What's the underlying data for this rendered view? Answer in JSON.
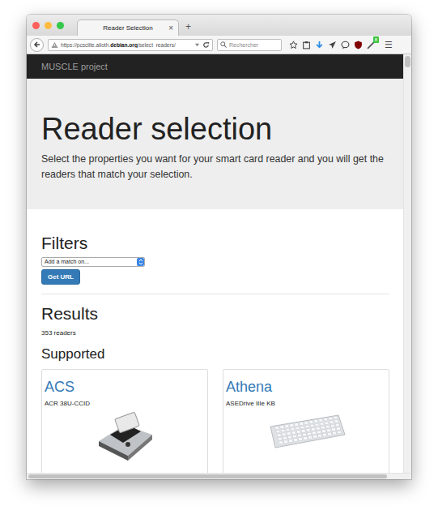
{
  "window": {
    "title": "Reader Selection",
    "tab_close": "×",
    "new_tab": "+"
  },
  "toolbar": {
    "url": {
      "prefix": "https://pcsclite.alioth.",
      "domain": "debian.org",
      "path": "/select_readers/"
    },
    "search": {
      "placeholder": "Rechercher"
    },
    "badge": "8",
    "menu": "☰"
  },
  "navbar": {
    "brand": "MUSCLE project"
  },
  "jumbotron": {
    "title": "Reader selection",
    "lead": "Select the properties you want for your smart card reader and you will get the readers that match your selection."
  },
  "filters": {
    "heading": "Filters",
    "select_placeholder": "Add a match on...",
    "button": "Get URL"
  },
  "results": {
    "heading": "Results",
    "count": "353 readers",
    "section": "Supported",
    "cards": [
      {
        "vendor": "ACS",
        "model": "ACR 38U-CCID",
        "kind": "reader"
      },
      {
        "vendor": "Athena",
        "model": "ASEDrive IIIe KB",
        "kind": "keyboard"
      }
    ]
  }
}
